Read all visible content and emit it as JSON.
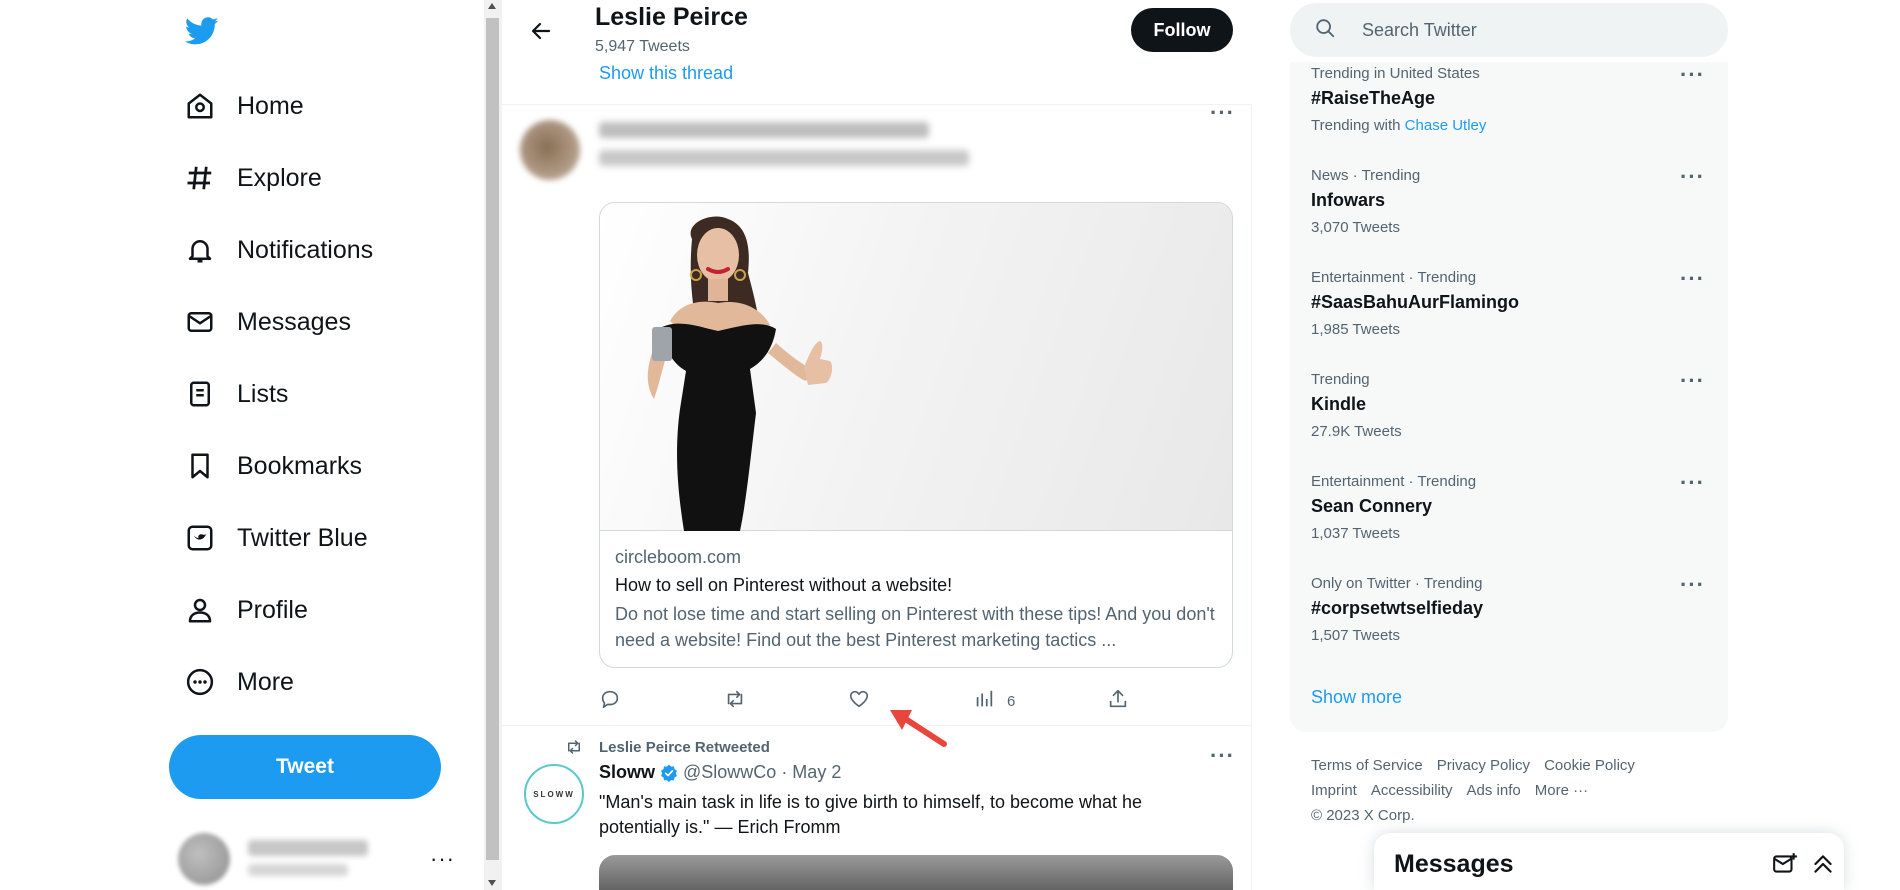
{
  "nav": {
    "items": [
      {
        "label": "Home",
        "icon": "home-icon"
      },
      {
        "label": "Explore",
        "icon": "hashtag-icon"
      },
      {
        "label": "Notifications",
        "icon": "bell-icon"
      },
      {
        "label": "Messages",
        "icon": "mail-icon"
      },
      {
        "label": "Lists",
        "icon": "list-icon"
      },
      {
        "label": "Bookmarks",
        "icon": "bookmark-icon"
      },
      {
        "label": "Twitter Blue",
        "icon": "twitter-blue-icon"
      },
      {
        "label": "Profile",
        "icon": "person-icon"
      },
      {
        "label": "More",
        "icon": "more-circle-icon"
      }
    ],
    "tweet_button": "Tweet"
  },
  "header": {
    "name": "Leslie Peirce",
    "tweet_count": "5,947 Tweets",
    "thread_link": "Show this thread",
    "follow_label": "Follow"
  },
  "tweet1": {
    "card": {
      "domain": "circleboom.com",
      "title": "How to sell on Pinterest without a website!",
      "description": "Do not lose time and start selling on Pinterest with these tips! And you don't need a website! Find out the best Pinterest marketing tactics ..."
    },
    "views": "6"
  },
  "tweet2": {
    "retweet_label": "Leslie Peirce Retweeted",
    "avatar_text": "SLOWW",
    "name": "Sloww",
    "handle_date": "@SlowwCo · May 2",
    "text": "\"Man's main task in life is to give birth to himself, to become what he potentially is.\" — Erich Fromm"
  },
  "search": {
    "placeholder": "Search Twitter"
  },
  "trends": [
    {
      "context": "Trending in United States",
      "name": "#RaiseTheAge",
      "meta_prefix": "Trending with",
      "meta_link": "Chase Utley"
    },
    {
      "context": "News · Trending",
      "name": "Infowars",
      "meta": "3,070 Tweets"
    },
    {
      "context": "Entertainment · Trending",
      "name": "#SaasBahuAurFlamingo",
      "meta": "1,985 Tweets"
    },
    {
      "context": "Trending",
      "name": "Kindle",
      "meta": "27.9K Tweets"
    },
    {
      "context": "Entertainment · Trending",
      "name": "Sean Connery",
      "meta": "1,037 Tweets"
    },
    {
      "context": "Only on Twitter · Trending",
      "name": "#corpsetwtselfieday",
      "meta": "1,507 Tweets"
    }
  ],
  "show_more": "Show more",
  "footer": {
    "links": [
      "Terms of Service",
      "Privacy Policy",
      "Cookie Policy",
      "Imprint",
      "Accessibility",
      "Ads info",
      "More ···"
    ],
    "copyright": "© 2023 X Corp."
  },
  "messages_drawer": {
    "title": "Messages"
  },
  "colors": {
    "accent": "#1d9bf0",
    "text": "#0f1419",
    "secondary": "#536471",
    "arrow": "#e8453c"
  }
}
